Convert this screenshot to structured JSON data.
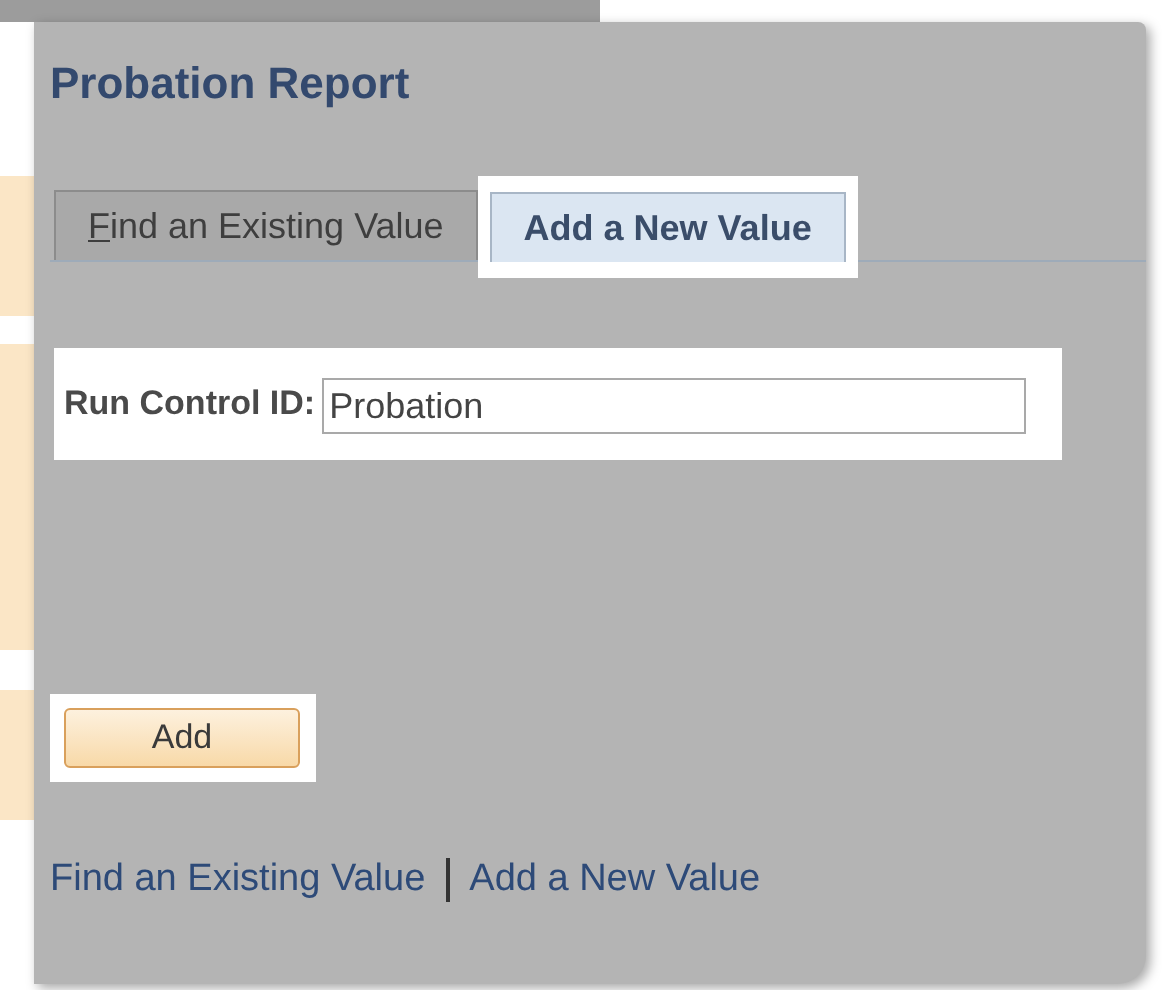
{
  "page": {
    "title": "Probation Report"
  },
  "tabs": [
    {
      "label": "Find an Existing Value",
      "selected": false,
      "access_key_underlined": true,
      "highlighted": false
    },
    {
      "label": "Add a New Value",
      "selected": true,
      "access_key_underlined": false,
      "highlighted": true
    }
  ],
  "run_control": {
    "label": "Run Control ID:",
    "value": "Probation",
    "highlighted": true
  },
  "add_button": {
    "label": "Add",
    "highlighted": true
  },
  "footer_links": [
    {
      "label": "Find an Existing Value"
    },
    {
      "label": "Add a New Value"
    }
  ]
}
